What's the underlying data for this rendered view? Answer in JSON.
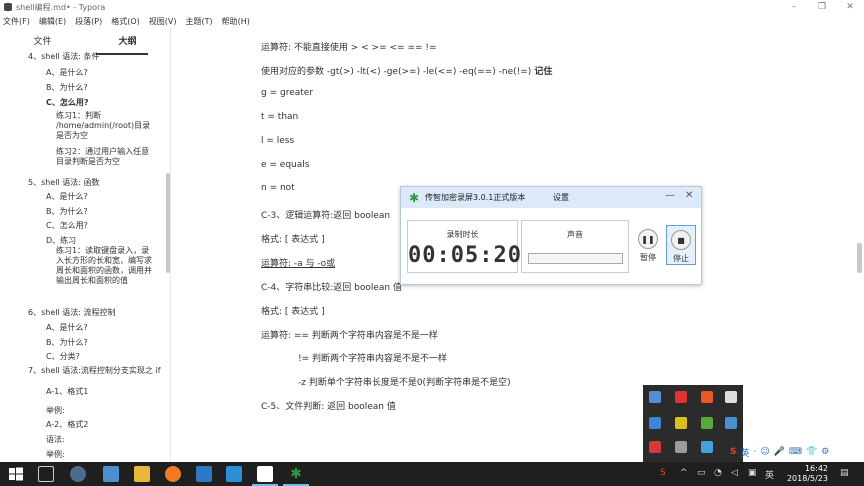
{
  "window": {
    "title": "shell编程.md• - Typora",
    "controls": [
      "–",
      "❐",
      "✕"
    ]
  },
  "menu": [
    "文件(F)",
    "编辑(E)",
    "段落(P)",
    "格式(O)",
    "视图(V)",
    "主题(T)",
    "帮助(H)"
  ],
  "sidebar": {
    "tabs": [
      "文件",
      "大纲"
    ],
    "active_tab": "大纲",
    "outline": [
      {
        "text": "4、shell 语法: 条件",
        "level": 0
      },
      {
        "text": "A、是什么?",
        "level": 1
      },
      {
        "text": "B、为什么?",
        "level": 1
      },
      {
        "text": "C、怎么用?",
        "level": 1,
        "active": true
      },
      {
        "text": "练习1：判断 /home/admin(/root)目录是否为空",
        "level": 2
      },
      {
        "text": "练习2：通过用户输入任意目录判断是否为空",
        "level": 2
      },
      {
        "text": "5、shell 语法: 函数",
        "level": 0
      },
      {
        "text": "A、是什么?",
        "level": 1
      },
      {
        "text": "B、为什么?",
        "level": 1
      },
      {
        "text": "C、怎么用?",
        "level": 1
      },
      {
        "text": "D、练习",
        "level": 1
      },
      {
        "text": "练习1：读取键盘录入，录入长方形的长和宽，编写求周长和面积的函数，调用并输出周长和面积的值",
        "level": 2
      },
      {
        "text": "6、shell 语法: 流程控制",
        "level": 0
      },
      {
        "text": "A、是什么?",
        "level": 1
      },
      {
        "text": "B、为什么?",
        "level": 1
      },
      {
        "text": "C、分类?",
        "level": 1
      },
      {
        "text": "7、shell 语法:流程控制分支实现之 if",
        "level": 0
      },
      {
        "text": "A-1、格式1",
        "level": 1
      },
      {
        "text": "举例:",
        "level": 1
      },
      {
        "text": "A-2、格式2",
        "level": 1
      },
      {
        "text": "语法:",
        "level": 1
      },
      {
        "text": "举例:",
        "level": 1
      }
    ],
    "bottom_icons": [
      "‹",
      "</>"
    ]
  },
  "editor": {
    "lines": [
      {
        "text": "运算符: 不能直接使用 > < >= <= == !="
      },
      {
        "text": "使用对应的参数  -gt(>) -lt(<) -ge(>=) -le(<=) -eq(==) -ne(!=)",
        "strong": "记住"
      },
      {
        "text": "g = greater"
      },
      {
        "text": "t = than"
      },
      {
        "text": "l = less"
      },
      {
        "text": "e = equals"
      },
      {
        "text": "n = not"
      },
      {
        "text": "C-3、逻辑运算符:返回 boolean"
      },
      {
        "text": "格式: [ 表达式 ]"
      },
      {
        "text": "运算符: -a 与          -o或"
      },
      {
        "text": "C-4、字符串比较:返回 boolean 值"
      },
      {
        "text": "格式: [ 表达式 ]"
      },
      {
        "text": "运算符: == 判断两个字符串内容是不是一样"
      },
      {
        "text": "!= 判断两个字符串内容是不是不一样"
      },
      {
        "text": "-z 判断单个字符串长度是不是0(判断字符串是不是空)"
      },
      {
        "text": "C-5、文件判断: 返回 boolean 值"
      }
    ]
  },
  "recorder": {
    "title": "传智加密录屏3.0.1正式版本",
    "settings": "设置",
    "duration_label": "录制时长",
    "timer": "00:05:20",
    "sound_label": "声音",
    "pause_label": "暂停",
    "stop_label": "停止",
    "minimize": "—",
    "close": "✕"
  },
  "ime": {
    "items": [
      "S",
      "英",
      "·",
      "☺",
      "🎤",
      "⌨",
      "👕",
      "⚙"
    ]
  },
  "taskbar": {
    "time": "16:42",
    "date": "2018/5/23"
  },
  "colors": {
    "accent": "#76b9ed",
    "taskbar": "#1f1f1f",
    "recorder_title": "#dbe9f8"
  }
}
